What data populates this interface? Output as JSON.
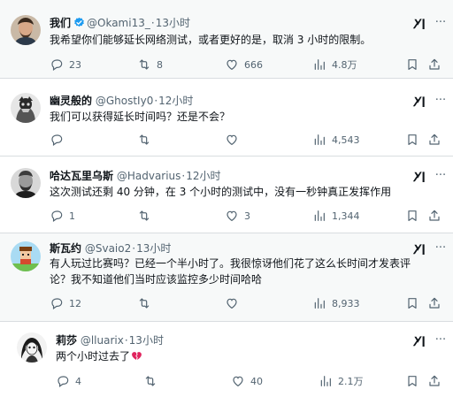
{
  "posts": [
    {
      "name": "我们",
      "verified": true,
      "handle": "@Okami13_",
      "separator": "·",
      "time": "13小时",
      "lines": [
        "我希望你们能够延长网络测试，或者更好的是，取消 3 小时的限制。"
      ],
      "replies": "23",
      "reposts": "8",
      "likes": "666",
      "views": "4.8万"
    },
    {
      "name": "幽灵般的",
      "verified": false,
      "handle": "@GhostIy0",
      "separator": "·",
      "time": "12小时",
      "lines": [
        "我们可以获得延长时间吗？还是不会？"
      ],
      "replies": "",
      "reposts": "",
      "likes": "",
      "views": "4,543"
    },
    {
      "name": "哈达瓦里乌斯",
      "verified": false,
      "handle": "@Hadvarius",
      "separator": "·",
      "time": "12小时",
      "lines": [
        "这次测试还剩 40 分钟，在 3 个小时的测试中，没有一秒钟真正发挥作用"
      ],
      "replies": "1",
      "reposts": "",
      "likes": "3",
      "views": "1,344"
    },
    {
      "name": "斯瓦约",
      "verified": false,
      "handle": "@Svaio2",
      "separator": "·",
      "time": "13小时",
      "lines": [
        "有人玩过比赛吗？已经一个半小时了。我很惊讶他们花了这么长时间才发表评",
        "论？我不知道他们当时应该监控多少时间哈哈"
      ],
      "replies": "12",
      "reposts": "",
      "likes": "",
      "views": "8,933"
    },
    {
      "name": "莉莎",
      "verified": false,
      "handle": "@lluarix",
      "separator": "·",
      "time": "13小时",
      "lines": [
        "两个小时过去了"
      ],
      "replies": "4",
      "reposts": "",
      "likes": "40",
      "views": "2.1万"
    }
  ],
  "icons": {
    "reply": "reply-icon",
    "repost": "repost-icon",
    "like": "like-icon",
    "views": "views-icon",
    "bookmark": "bookmark-icon",
    "share": "share-icon",
    "grok": "grok-icon",
    "more": "more-icon",
    "verified": "verified-badge-icon",
    "emoji": "broken-heart-emoji"
  },
  "colors": {
    "text": "#0f1419",
    "muted": "#536471",
    "verified": "#1d9bf0",
    "broken_heart": "#e0245e",
    "highlight_bg": "#f7f9f9"
  }
}
